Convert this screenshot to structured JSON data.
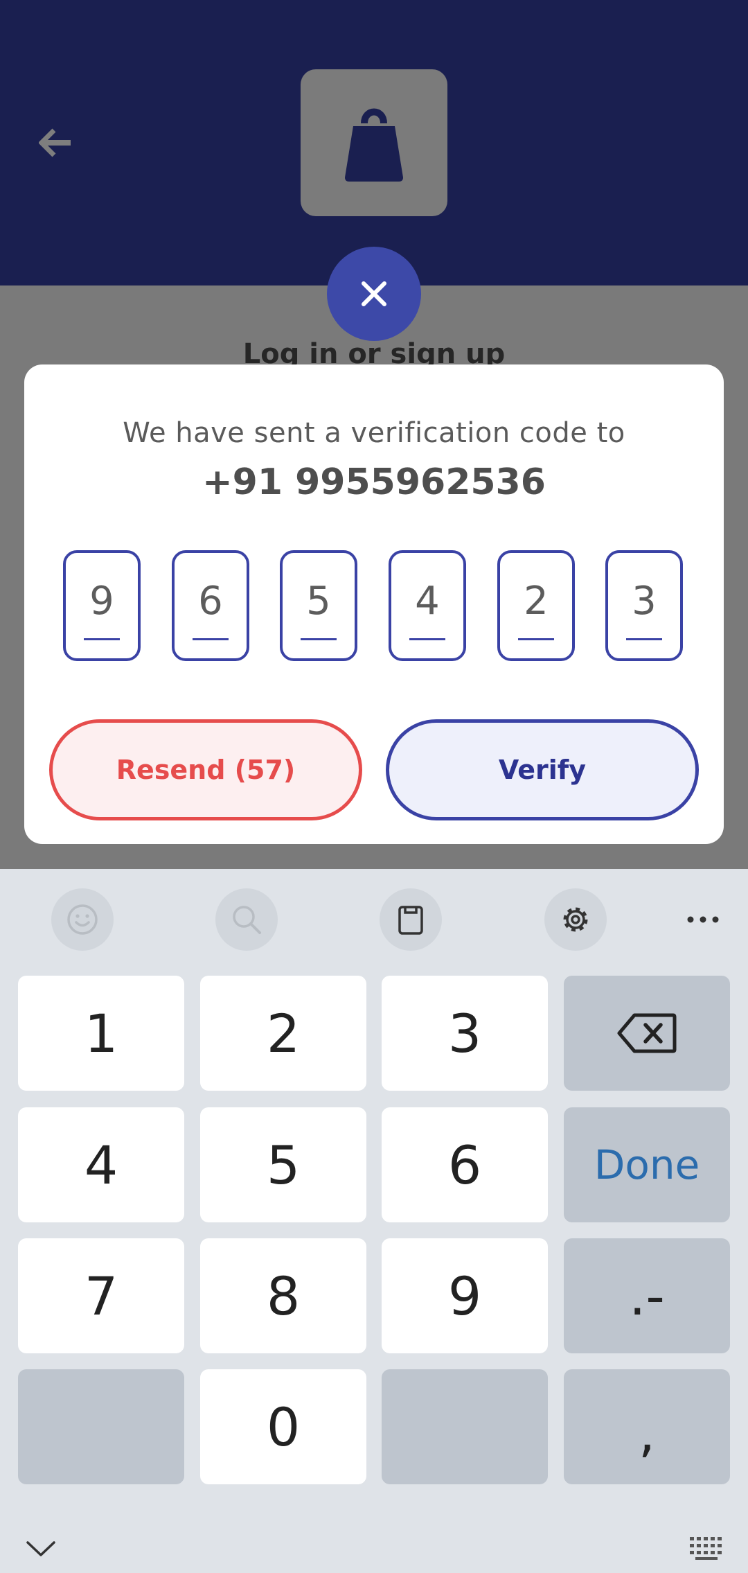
{
  "screen": {
    "title_behind": "Log in or sign up"
  },
  "dialog": {
    "message": "We have sent a verification code to",
    "phone": "+91 9955962536",
    "otp_digits": [
      "9",
      "6",
      "5",
      "4",
      "2",
      "3"
    ],
    "resend_label": "Resend (57)",
    "verify_label": "Verify"
  },
  "keyboard": {
    "toolbar": [
      "emoji-icon",
      "search-icon",
      "clipboard-icon",
      "settings-icon",
      "more-icon"
    ],
    "keys": {
      "k1": "1",
      "k2": "2",
      "k3": "3",
      "k4": "4",
      "k5": "5",
      "k6": "6",
      "k7": "7",
      "k8": "8",
      "k9": "9",
      "k0": "0",
      "done": "Done",
      "dot_dash": ".-",
      "comma": ","
    }
  },
  "colors": {
    "header_bg": "#1a1f50",
    "accent": "#3a42a5",
    "danger": "#e64c4c"
  }
}
